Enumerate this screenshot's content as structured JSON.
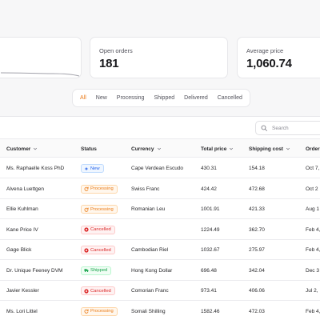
{
  "stats": [
    {
      "label": "",
      "value": ""
    },
    {
      "label": "Open orders",
      "value": "181"
    },
    {
      "label": "Average price",
      "value": "1,060.74"
    }
  ],
  "tabs": [
    "All",
    "New",
    "Processing",
    "Shipped",
    "Delivered",
    "Cancelled"
  ],
  "active_tab": "All",
  "search": {
    "placeholder": "Search"
  },
  "columns": [
    "Customer",
    "Status",
    "Currency",
    "Total price",
    "Shipping cost",
    "Order"
  ],
  "status_colors": {
    "New": {
      "text": "#2563eb",
      "bg": "#eff6ff",
      "border": "#bfdbfe",
      "icon": "sparkles-icon"
    },
    "Processing": {
      "text": "#ea7a17",
      "bg": "#fff7ed",
      "border": "#fed7aa",
      "icon": "refresh-icon"
    },
    "Cancelled": {
      "text": "#dc2626",
      "bg": "#fef2f2",
      "border": "#fecaca",
      "icon": "x-circle-icon"
    },
    "Shipped": {
      "text": "#16a34a",
      "bg": "#f0fdf4",
      "border": "#bbf7d0",
      "icon": "truck-icon"
    }
  },
  "rows": [
    {
      "customer": "Ms. Raphaelle Koss PhD",
      "status": "New",
      "currency": "Cape Verdean Escudo",
      "total": "430.31",
      "shipping": "154.18",
      "date": "Oct 7,"
    },
    {
      "customer": "Alvena Luettgen",
      "status": "Processing",
      "currency": "Swiss Franc",
      "total": "424.42",
      "shipping": "472.68",
      "date": "Oct 2"
    },
    {
      "customer": "Ellie Kuhlman",
      "status": "Processing",
      "currency": "Romanian Leu",
      "total": "1001.91",
      "shipping": "421.33",
      "date": "Aug 1"
    },
    {
      "customer": "Kane Price IV",
      "status": "Cancelled",
      "currency": "",
      "total": "1224.49",
      "shipping": "362.70",
      "date": "Feb 4,"
    },
    {
      "customer": "Gage Blick",
      "status": "Cancelled",
      "currency": "Cambodian Riel",
      "total": "1032.67",
      "shipping": "275.97",
      "date": "Feb 4,"
    },
    {
      "customer": "Dr. Unique Feeney DVM",
      "status": "Shipped",
      "currency": "Hong Kong Dollar",
      "total": "696.48",
      "shipping": "342.04",
      "date": "Dec 3"
    },
    {
      "customer": "Javier Kessler",
      "status": "Cancelled",
      "currency": "Comorian Franc",
      "total": "973.41",
      "shipping": "406.06",
      "date": "Jul 2,"
    },
    {
      "customer": "Ms. Lori Littel",
      "status": "Processing",
      "currency": "Somali Shilling",
      "total": "1582.46",
      "shipping": "472.03",
      "date": "Feb 4,"
    }
  ]
}
